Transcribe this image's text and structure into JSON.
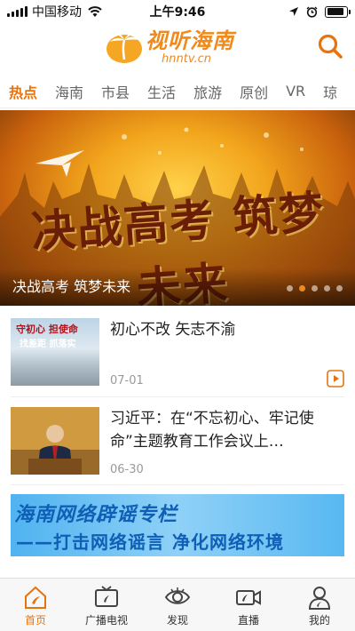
{
  "status_bar": {
    "carrier": "中国移动",
    "time": "上午9:46",
    "battery_level": 0.9
  },
  "header": {
    "logo_cn": "视听海南",
    "logo_en": "hnntv.cn",
    "search_icon": "search-icon"
  },
  "tabs": [
    {
      "label": "热点",
      "active": true
    },
    {
      "label": "海南",
      "active": false
    },
    {
      "label": "市县",
      "active": false
    },
    {
      "label": "生活",
      "active": false
    },
    {
      "label": "旅游",
      "active": false
    },
    {
      "label": "原创",
      "active": false
    },
    {
      "label": "VR",
      "active": false
    },
    {
      "label": "琼",
      "active": false
    }
  ],
  "banner": {
    "art_text": "决战高考 筑梦未来",
    "caption": "决战高考 筑梦未来",
    "dot_count": 5,
    "active_dot": 1
  },
  "news": [
    {
      "title": "初心不改 矢志不渝",
      "date": "07-01",
      "has_video": true,
      "thumb_text_1": "守初心 担使命",
      "thumb_text_2": "找差距 抓落实"
    },
    {
      "title": "习近平：在“不忘初心、牢记使命”主题教育工作会议上…",
      "date": "06-30",
      "has_video": false
    }
  ],
  "promo": {
    "line1": "海南网络辟谣专栏",
    "line2": "——打击网络谣言 净化网络环境"
  },
  "bottom_nav": [
    {
      "label": "首页",
      "icon": "home-icon",
      "active": true
    },
    {
      "label": "广播电视",
      "icon": "tv-icon",
      "active": false
    },
    {
      "label": "发现",
      "icon": "eye-icon",
      "active": false
    },
    {
      "label": "直播",
      "icon": "live-camera-icon",
      "active": false
    },
    {
      "label": "我的",
      "icon": "user-icon",
      "active": false
    }
  ],
  "colors": {
    "accent": "#e8730c",
    "logo": "#f08a1c",
    "promo_text": "#0f5fb6"
  }
}
